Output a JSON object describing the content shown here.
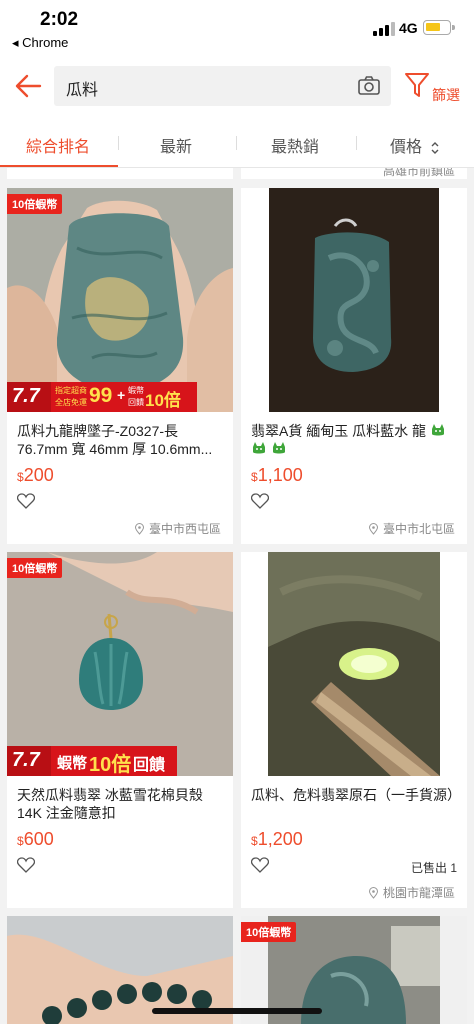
{
  "status_bar": {
    "time": "2:02",
    "back_app": "◂ Chrome",
    "network": "4G"
  },
  "search": {
    "query": "瓜料",
    "filter_label": "篩選"
  },
  "tabs": [
    {
      "label": "綜合排名"
    },
    {
      "label": "最新"
    },
    {
      "label": "最熱銷"
    },
    {
      "label": "價格"
    }
  ],
  "partial_top_location": "高雄市前鎮區",
  "products": [
    {
      "badge": "10倍蝦幣",
      "title": "瓜料九龍牌墜子-Z0327-長 76.7mm 寬 46mm 厚 10.6mm...",
      "currency": "$",
      "price": "200",
      "sold": "",
      "location": "臺中市西屯區",
      "promo": {
        "big": "7.7",
        "line1": "指定超商",
        "line2": "全店免運",
        "num": "99",
        "sub": "+",
        "right1": "蝦幣",
        "right2": "回饋",
        "right_big": "10倍"
      }
    },
    {
      "badge": "",
      "title": "翡翠A貨 緬甸玉 瓜料藍水 龍",
      "currency": "$",
      "price": "1,100",
      "sold": "",
      "location": "臺中市北屯區"
    },
    {
      "badge": "10倍蝦幣",
      "title": "天然瓜料翡翠 冰藍雪花棉貝殼 14K 注金隨意扣",
      "currency": "$",
      "price": "600",
      "sold": "",
      "location": "",
      "promo2": {
        "big": "7.7",
        "text1": "蝦幣",
        "text2": "10倍",
        "text3": "回饋"
      }
    },
    {
      "badge": "",
      "title": "瓜料、危料翡翠原石（一手貨源）",
      "currency": "$",
      "price": "1,200",
      "sold": "已售出 1",
      "location": "桃園市龍潭區"
    },
    {
      "badge": "",
      "title": "",
      "currency": "",
      "price": "",
      "sold": "",
      "location": ""
    },
    {
      "badge": "10倍蝦幣",
      "title": "",
      "currency": "",
      "price": "",
      "sold": "",
      "location": ""
    }
  ],
  "colors": {
    "accent": "#ee4d2d",
    "badge": "#e8241d",
    "jade": "#4f7a78"
  }
}
